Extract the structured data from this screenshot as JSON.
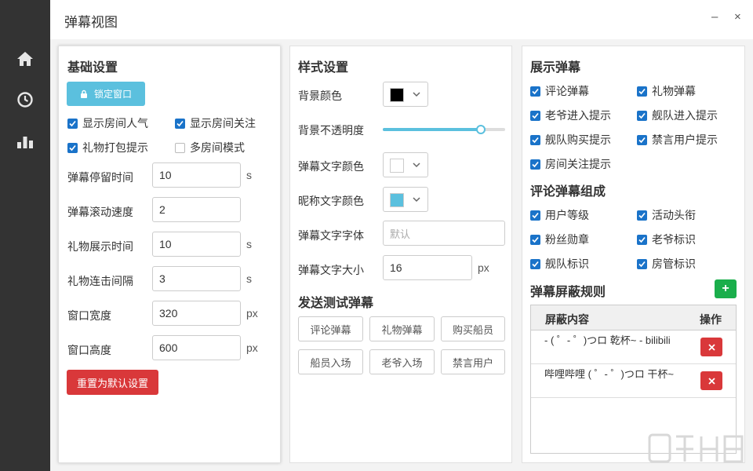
{
  "app": {
    "title": "弹幕视图"
  },
  "window_controls": {
    "minimize": "–",
    "close": "×"
  },
  "sidebar": {
    "items": [
      {
        "icon": "home-icon"
      },
      {
        "icon": "clock-icon"
      },
      {
        "icon": "bar-chart-icon"
      }
    ]
  },
  "basic": {
    "title": "基础设置",
    "lock_button": "锁定窗口",
    "checkboxes": [
      {
        "label": "显示房间人气",
        "checked": true
      },
      {
        "label": "显示房间关注",
        "checked": true
      },
      {
        "label": "礼物打包提示",
        "checked": true
      },
      {
        "label": "多房间模式",
        "checked": false
      }
    ],
    "fields": [
      {
        "label": "弹幕停留时间",
        "value": "10",
        "unit": "s"
      },
      {
        "label": "弹幕滚动速度",
        "value": "2",
        "unit": ""
      },
      {
        "label": "礼物展示时间",
        "value": "10",
        "unit": "s"
      },
      {
        "label": "礼物连击间隔",
        "value": "3",
        "unit": "s"
      },
      {
        "label": "窗口宽度",
        "value": "320",
        "unit": "px"
      },
      {
        "label": "窗口高度",
        "value": "600",
        "unit": "px"
      }
    ],
    "reset_button": "重置为默认设置"
  },
  "style": {
    "title": "样式设置",
    "bg_color_label": "背景颜色",
    "bg_color": "#000000",
    "opacity_label": "背景不透明度",
    "opacity_value": 0.8,
    "text_color_label": "弹幕文字颜色",
    "text_color": "#ffffff",
    "nick_color_label": "昵称文字颜色",
    "nick_color": "#5bc0de",
    "font_label": "弹幕文字字体",
    "font_placeholder": "默认",
    "size_label": "弹幕文字大小",
    "size_value": "16",
    "size_unit": "px"
  },
  "test": {
    "title": "发送测试弹幕",
    "buttons": [
      "评论弹幕",
      "礼物弹幕",
      "购买船员",
      "船员入场",
      "老爷入场",
      "禁言用户"
    ]
  },
  "display": {
    "title": "展示弹幕",
    "checkboxes": [
      {
        "label": "评论弹幕",
        "checked": true
      },
      {
        "label": "礼物弹幕",
        "checked": true
      },
      {
        "label": "老爷进入提示",
        "checked": true
      },
      {
        "label": "舰队进入提示",
        "checked": true
      },
      {
        "label": "舰队购买提示",
        "checked": true
      },
      {
        "label": "禁言用户提示",
        "checked": true
      },
      {
        "label": "房间关注提示",
        "checked": true
      }
    ],
    "compose_title": "评论弹幕组成",
    "compose": [
      {
        "label": "用户等级",
        "checked": true
      },
      {
        "label": "活动头衔",
        "checked": true
      },
      {
        "label": "粉丝勋章",
        "checked": true
      },
      {
        "label": "老爷标识",
        "checked": true
      },
      {
        "label": "舰队标识",
        "checked": true
      },
      {
        "label": "房管标识",
        "checked": true
      }
    ],
    "block_title": "弹幕屏蔽规则",
    "add_button": "+",
    "block_table": {
      "headers": [
        "屏蔽内容",
        "操作"
      ],
      "rows": [
        {
          "content": "- ( ゜- ゜)つロ 乾杯~ - bilibili"
        },
        {
          "content": "哔哩哔哩 ( ゜- ゜)つロ 干杯~"
        }
      ]
    }
  },
  "accent": {
    "primary": "#5bc0de",
    "danger": "#d9383a",
    "success": "#1aae4b",
    "check": "#1a73c9"
  }
}
